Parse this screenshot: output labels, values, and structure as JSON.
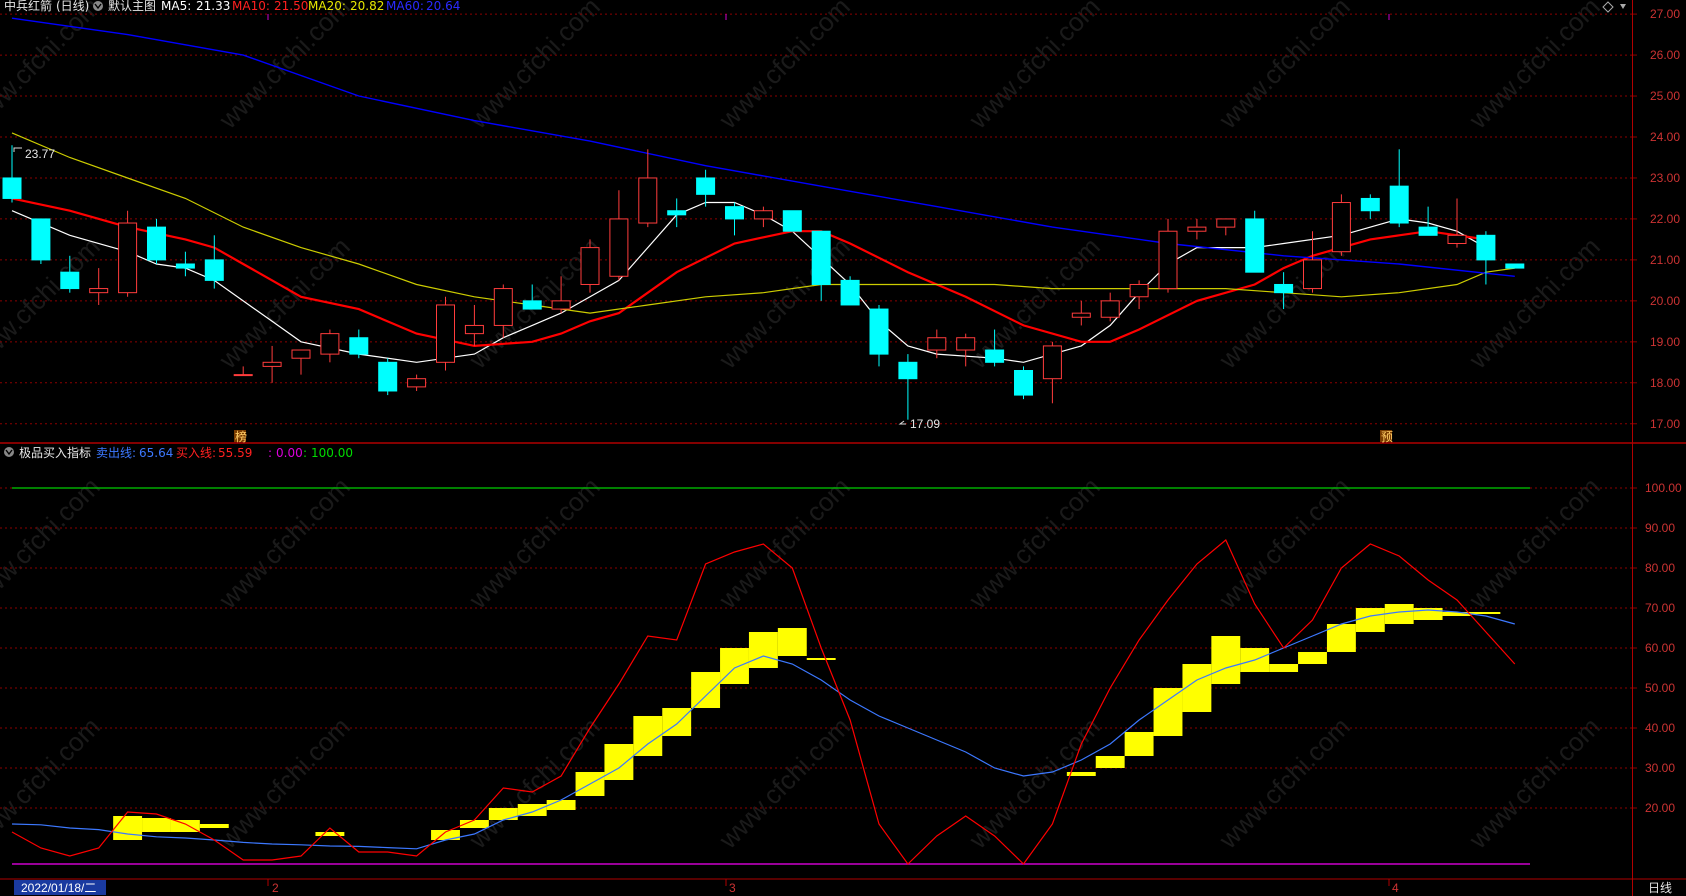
{
  "header": {
    "stock_name": "中兵红箭",
    "period": "(日线)",
    "template": "默认主图",
    "ma5_label": "MA5:",
    "ma5_value": "21.33",
    "ma10_label": "MA10:",
    "ma10_value": "21.50",
    "ma20_label": "MA20:",
    "ma20_value": "20.82",
    "ma60_label": "MA60:",
    "ma60_value": "20.64"
  },
  "indicator_header": {
    "name": "极品买入指标",
    "sell_label": "卖出线:",
    "sell_value": "65.64",
    "buy_label": "买入线:",
    "buy_value": "55.59",
    "aux_label": ":",
    "aux_value": "0.00",
    "aux2_label": ":",
    "aux2_value": "100.00"
  },
  "annotations": {
    "high_label": "23.77",
    "low_label": "17.09",
    "marker1": "榜",
    "marker2": "预"
  },
  "footer": {
    "date_label": "2022/01/18/二",
    "month_2": "2",
    "month_3": "3",
    "month_4": "4",
    "period_button": "日线"
  },
  "watermark": "www.cfchi.com",
  "colors": {
    "up": "#ff3c3c",
    "down": "#00ffff",
    "ma5": "#ffffff",
    "ma10": "#ff0000",
    "ma20": "#cccc00",
    "ma60": "#0000ff",
    "sell_line": "#3c78ff",
    "buy_line": "#ff0000",
    "bar": "#ffff00",
    "grid": "#8b0000",
    "axis_text": "#cc3333"
  },
  "chart_data": [
    {
      "type": "candlestick",
      "title": "中兵红箭 (日线)",
      "ylim": [
        16.75,
        27.1
      ],
      "y_ticks": [
        17.0,
        18.0,
        19.0,
        20.0,
        21.0,
        22.0,
        23.0,
        24.0,
        25.0,
        26.0,
        27.0
      ],
      "y_tick_labels": [
        "17.00",
        "18.00",
        "19.00",
        "20.00",
        "21.00",
        "22.00",
        "23.00",
        "24.00",
        "25.00",
        "26.00",
        "27.00"
      ],
      "ohlc": [
        [
          23.0,
          23.8,
          22.4,
          22.5
        ],
        [
          22.0,
          22.0,
          20.9,
          21.0
        ],
        [
          20.7,
          21.1,
          20.2,
          20.3
        ],
        [
          20.2,
          20.8,
          19.9,
          20.3
        ],
        [
          20.2,
          22.2,
          20.1,
          21.9
        ],
        [
          21.8,
          22.0,
          20.9,
          21.0
        ],
        [
          20.9,
          21.2,
          20.6,
          20.8
        ],
        [
          21.0,
          21.6,
          20.3,
          20.5
        ],
        [
          18.2,
          18.4,
          18.2,
          18.2
        ],
        [
          18.4,
          18.9,
          18.0,
          18.5
        ],
        [
          18.6,
          18.8,
          18.2,
          18.8
        ],
        [
          18.7,
          19.3,
          18.5,
          19.2
        ],
        [
          19.1,
          19.3,
          18.6,
          18.7
        ],
        [
          18.5,
          18.6,
          17.7,
          17.8
        ],
        [
          17.9,
          18.2,
          17.8,
          18.1
        ],
        [
          18.5,
          20.1,
          18.3,
          19.9
        ],
        [
          19.2,
          19.9,
          18.9,
          19.4
        ],
        [
          19.4,
          20.4,
          19.1,
          20.3
        ],
        [
          20.0,
          20.4,
          19.9,
          19.8
        ],
        [
          19.8,
          20.6,
          19.7,
          20.0
        ],
        [
          20.4,
          21.5,
          20.2,
          21.3
        ],
        [
          20.6,
          22.7,
          20.5,
          22.0
        ],
        [
          21.9,
          23.7,
          21.8,
          23.0
        ],
        [
          22.2,
          22.5,
          21.8,
          22.1
        ],
        [
          23.0,
          23.2,
          22.3,
          22.6
        ],
        [
          22.3,
          22.4,
          21.6,
          22.0
        ],
        [
          22.0,
          22.3,
          21.8,
          22.2
        ],
        [
          22.2,
          22.2,
          21.7,
          21.7
        ],
        [
          21.7,
          21.7,
          20.0,
          20.4
        ],
        [
          20.5,
          20.6,
          19.9,
          19.9
        ],
        [
          19.8,
          19.9,
          18.4,
          18.7
        ],
        [
          18.5,
          18.7,
          17.1,
          18.1
        ],
        [
          18.8,
          19.3,
          18.6,
          19.1
        ],
        [
          18.8,
          19.2,
          18.4,
          19.1
        ],
        [
          18.8,
          19.3,
          18.4,
          18.5
        ],
        [
          18.3,
          18.4,
          17.6,
          17.7
        ],
        [
          18.1,
          19.0,
          17.5,
          18.9
        ],
        [
          19.6,
          20.0,
          19.4,
          19.7
        ],
        [
          19.6,
          20.2,
          19.5,
          20.0
        ],
        [
          20.1,
          20.5,
          19.8,
          20.4
        ],
        [
          20.3,
          22.0,
          20.2,
          21.7
        ],
        [
          21.7,
          22.0,
          21.5,
          21.8
        ],
        [
          21.8,
          22.0,
          21.6,
          22.0
        ],
        [
          22.0,
          22.2,
          20.7,
          20.7
        ],
        [
          20.4,
          20.7,
          19.8,
          20.2
        ],
        [
          20.3,
          21.7,
          20.2,
          21.0
        ],
        [
          21.2,
          22.6,
          21.1,
          22.4
        ],
        [
          22.5,
          22.6,
          22.0,
          22.2
        ],
        [
          22.8,
          23.7,
          21.8,
          21.9
        ],
        [
          21.8,
          22.3,
          21.6,
          21.6
        ],
        [
          21.4,
          22.5,
          21.3,
          21.6
        ],
        [
          21.6,
          21.7,
          20.4,
          21.0
        ],
        [
          20.9,
          20.9,
          20.8,
          20.8
        ]
      ],
      "ma_series": [
        {
          "name": "MA5",
          "points": [
            [
              0,
              22.2
            ],
            [
              2,
              21.6
            ],
            [
              4,
              21.2
            ],
            [
              5,
              20.9
            ],
            [
              6,
              20.8
            ],
            [
              7,
              20.5
            ],
            [
              8,
              20.0
            ],
            [
              9,
              19.5
            ],
            [
              10,
              19.0
            ],
            [
              12,
              18.7
            ],
            [
              14,
              18.5
            ],
            [
              16,
              18.7
            ],
            [
              17,
              19.1
            ],
            [
              18,
              19.4
            ],
            [
              19,
              19.7
            ],
            [
              21,
              20.5
            ],
            [
              22,
              21.3
            ],
            [
              23,
              22.1
            ],
            [
              24,
              22.4
            ],
            [
              25,
              22.4
            ],
            [
              26,
              22.1
            ],
            [
              27,
              21.7
            ],
            [
              29,
              20.4
            ],
            [
              30,
              19.5
            ],
            [
              31,
              18.9
            ],
            [
              32,
              18.7
            ],
            [
              34,
              18.6
            ],
            [
              35,
              18.5
            ],
            [
              36,
              18.7
            ],
            [
              37,
              18.9
            ],
            [
              38,
              19.4
            ],
            [
              39,
              20.2
            ],
            [
              40,
              20.9
            ],
            [
              41,
              21.3
            ],
            [
              42,
              21.3
            ],
            [
              43,
              21.3
            ],
            [
              44,
              21.4
            ],
            [
              46,
              21.6
            ],
            [
              48,
              22.0
            ],
            [
              49,
              21.9
            ],
            [
              50,
              21.7
            ],
            [
              51,
              21.3
            ]
          ]
        },
        {
          "name": "MA10",
          "points": [
            [
              0,
              22.5
            ],
            [
              2,
              22.2
            ],
            [
              4,
              21.8
            ],
            [
              6,
              21.5
            ],
            [
              7,
              21.3
            ],
            [
              8,
              20.9
            ],
            [
              10,
              20.1
            ],
            [
              12,
              19.8
            ],
            [
              14,
              19.2
            ],
            [
              16,
              18.9
            ],
            [
              18,
              19.0
            ],
            [
              19,
              19.2
            ],
            [
              20,
              19.5
            ],
            [
              21,
              19.7
            ],
            [
              22,
              20.2
            ],
            [
              23,
              20.7
            ],
            [
              25,
              21.4
            ],
            [
              27,
              21.7
            ],
            [
              28,
              21.7
            ],
            [
              29,
              21.4
            ],
            [
              31,
              20.7
            ],
            [
              33,
              20.1
            ],
            [
              35,
              19.4
            ],
            [
              37,
              19.0
            ],
            [
              38,
              19.0
            ],
            [
              39,
              19.3
            ],
            [
              41,
              20.0
            ],
            [
              43,
              20.4
            ],
            [
              44,
              20.8
            ],
            [
              45,
              21.1
            ],
            [
              46,
              21.3
            ],
            [
              47,
              21.5
            ],
            [
              48,
              21.6
            ],
            [
              49,
              21.7
            ],
            [
              50,
              21.6
            ],
            [
              51,
              21.5
            ]
          ]
        },
        {
          "name": "MA20",
          "points": [
            [
              0,
              24.1
            ],
            [
              2,
              23.5
            ],
            [
              4,
              23.0
            ],
            [
              6,
              22.5
            ],
            [
              8,
              21.8
            ],
            [
              10,
              21.3
            ],
            [
              12,
              20.9
            ],
            [
              14,
              20.4
            ],
            [
              16,
              20.1
            ],
            [
              18,
              19.9
            ],
            [
              20,
              19.7
            ],
            [
              22,
              19.9
            ],
            [
              24,
              20.1
            ],
            [
              26,
              20.2
            ],
            [
              28,
              20.4
            ],
            [
              30,
              20.4
            ],
            [
              32,
              20.4
            ],
            [
              34,
              20.4
            ],
            [
              36,
              20.3
            ],
            [
              38,
              20.3
            ],
            [
              40,
              20.3
            ],
            [
              42,
              20.3
            ],
            [
              44,
              20.2
            ],
            [
              46,
              20.1
            ],
            [
              48,
              20.2
            ],
            [
              50,
              20.4
            ],
            [
              51,
              20.7
            ],
            [
              52,
              20.8
            ]
          ]
        },
        {
          "name": "MA60",
          "points": [
            [
              0,
              26.9
            ],
            [
              4,
              26.5
            ],
            [
              8,
              26.0
            ],
            [
              12,
              25.0
            ],
            [
              16,
              24.4
            ],
            [
              20,
              23.9
            ],
            [
              24,
              23.3
            ],
            [
              28,
              22.8
            ],
            [
              32,
              22.3
            ],
            [
              36,
              21.8
            ],
            [
              40,
              21.4
            ],
            [
              44,
              21.1
            ],
            [
              48,
              20.9
            ],
            [
              52,
              20.6
            ]
          ]
        }
      ]
    },
    {
      "type": "line",
      "title": "极品买入指标",
      "ylim": [
        4,
        105
      ],
      "y_ticks": [
        20,
        30,
        40,
        50,
        60,
        70,
        80,
        90,
        100
      ],
      "y_tick_labels": [
        "20.00",
        "30.00",
        "40.00",
        "50.00",
        "60.00",
        "70.00",
        "80.00",
        "90.00",
        "100.00"
      ],
      "x_labels": [
        "2022/01/18/二",
        "2",
        "3",
        "4"
      ],
      "series": [
        {
          "name": "卖出线",
          "values": [
            16,
            15.8,
            15,
            14.6,
            13.5,
            12.8,
            12.5,
            12,
            11.4,
            11,
            10.8,
            10.5,
            10.4,
            10.1,
            9.8,
            12,
            13.5,
            17,
            19,
            22,
            26,
            30,
            36,
            41,
            48,
            55,
            58,
            56,
            52,
            47,
            43,
            40,
            37,
            34,
            30,
            28,
            29,
            32,
            36,
            42,
            47,
            52,
            55,
            57,
            60,
            63,
            66,
            68,
            69,
            69.5,
            69,
            68,
            66
          ]
        },
        {
          "name": "买入线",
          "values": [
            14,
            10,
            8,
            10,
            19,
            18.5,
            16,
            12,
            7,
            7,
            8,
            15,
            9,
            9,
            8,
            14,
            17,
            25,
            24,
            28,
            40,
            51,
            63,
            62,
            81,
            84,
            86,
            80,
            60,
            42,
            16,
            6,
            13,
            18,
            13,
            6,
            16,
            36,
            50,
            62,
            72,
            81,
            87,
            71,
            60,
            67,
            80,
            86,
            83,
            77,
            72,
            64,
            56
          ]
        },
        {
          "name": "",
          "values": [
            100,
            100
          ]
        },
        {
          "name": "",
          "values": [
            0,
            0
          ]
        }
      ],
      "bars": [
        [
          4,
          12,
          18
        ],
        [
          5,
          14,
          17.5
        ],
        [
          6,
          14,
          17
        ],
        [
          7,
          15,
          16
        ],
        [
          11,
          13,
          14
        ],
        [
          15,
          12,
          14.5
        ],
        [
          16,
          15,
          17
        ],
        [
          17,
          17,
          20
        ],
        [
          18,
          18,
          21
        ],
        [
          19,
          19.5,
          22
        ],
        [
          20,
          23,
          29
        ],
        [
          21,
          27,
          36
        ],
        [
          22,
          33,
          43
        ],
        [
          23,
          38,
          45
        ],
        [
          24,
          45,
          54
        ],
        [
          25,
          51,
          60
        ],
        [
          26,
          55,
          64
        ],
        [
          27,
          58,
          65
        ],
        [
          28,
          57,
          57.5
        ],
        [
          37,
          28,
          29
        ],
        [
          38,
          30,
          33
        ],
        [
          39,
          33,
          39
        ],
        [
          40,
          38,
          50
        ],
        [
          41,
          44,
          56
        ],
        [
          42,
          51,
          63
        ],
        [
          43,
          54,
          60
        ],
        [
          44,
          54,
          56
        ],
        [
          45,
          56,
          59
        ],
        [
          46,
          59,
          66
        ],
        [
          47,
          64,
          70
        ],
        [
          48,
          66,
          71
        ],
        [
          49,
          67,
          70
        ],
        [
          50,
          68,
          69
        ],
        [
          51,
          68.5,
          69
        ]
      ]
    }
  ]
}
